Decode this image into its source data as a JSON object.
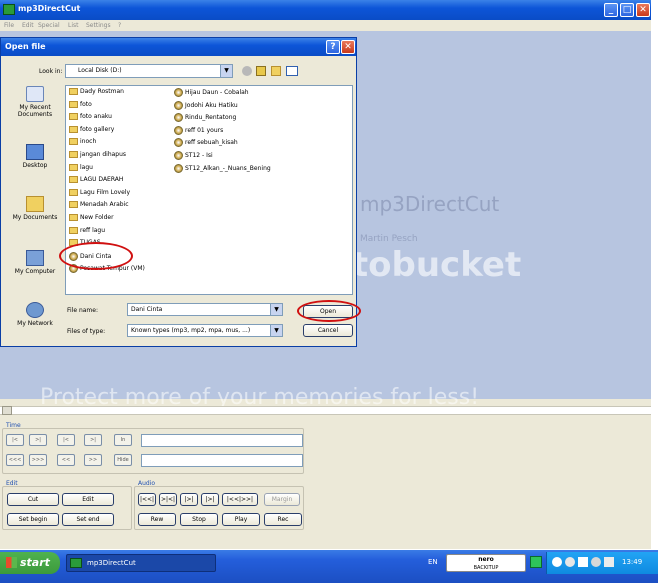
{
  "app": {
    "title": "mp3DirectCut",
    "menu": [
      "File",
      "Edit",
      "Special",
      "List",
      "Settings",
      "?"
    ],
    "window_buttons": [
      "_",
      "□",
      "✕"
    ],
    "background_title": "mp3DirectCut",
    "background_author": "Martin Pesch",
    "watermark_brand": "photobucket",
    "watermark_slogan": "Protect more of your memories for less!"
  },
  "dialog": {
    "title": "Open file",
    "help_btn": "?",
    "close_btn": "✕",
    "look_in_label": "Look in:",
    "look_in_value": "Local Disk (D:)",
    "places": [
      {
        "label": "My Recent Documents",
        "icon": "recent-documents-icon"
      },
      {
        "label": "Desktop",
        "icon": "desktop-icon"
      },
      {
        "label": "My Documents",
        "icon": "my-documents-icon"
      },
      {
        "label": "My Computer",
        "icon": "my-computer-icon"
      },
      {
        "label": "My Network",
        "icon": "my-network-icon"
      }
    ],
    "files_col1": [
      {
        "name": "Dady Rostman",
        "type": "folder"
      },
      {
        "name": "foto",
        "type": "folder"
      },
      {
        "name": "foto anaku",
        "type": "folder"
      },
      {
        "name": "foto gallery",
        "type": "folder"
      },
      {
        "name": "inoch",
        "type": "folder"
      },
      {
        "name": "jangan dihapus",
        "type": "folder"
      },
      {
        "name": "lagu",
        "type": "folder"
      },
      {
        "name": "LAGU DAERAH",
        "type": "folder"
      },
      {
        "name": "Lagu Film Lovely",
        "type": "folder"
      },
      {
        "name": "Menadah Arabic",
        "type": "folder"
      },
      {
        "name": "New Folder",
        "type": "folder"
      },
      {
        "name": "reff lagu",
        "type": "folder"
      },
      {
        "name": "TUGAS",
        "type": "folder"
      },
      {
        "name": "Dani Cinta",
        "type": "mp3"
      },
      {
        "name": "Pesawat Tempur (VM)",
        "type": "mp3"
      }
    ],
    "files_col2": [
      {
        "name": "Hijau Daun - Cobalah"
      },
      {
        "name": "Jodohi Aku Hatiku"
      },
      {
        "name": "Rindu_Rentatong"
      },
      {
        "name": "reff 01 yours"
      },
      {
        "name": "reff sebuah_kisah"
      },
      {
        "name": "ST12 - Isi"
      },
      {
        "name": "ST12_Alkan_-_Nuans_Bening"
      }
    ],
    "filename_label": "File name:",
    "filename_value": "Dani Cinta",
    "filetype_label": "Files of type:",
    "filetype_value": "Known types (mp3, mp2, mpa, mus, ...)",
    "open_btn": "Open",
    "cancel_btn": "Cancel"
  },
  "panel": {
    "time_label": "Time",
    "row1_buttons": [
      "|<",
      ">|",
      "|<",
      ">|"
    ],
    "row2_buttons": [
      "<<<",
      ">>>",
      "<<",
      ">>"
    ],
    "in_btn": "In",
    "hide_btn": "Hide",
    "edit_label": "Edit",
    "cut_btn": "Cut",
    "edit_btn": "Edit",
    "set_begin_btn": "Set begin",
    "set_end_btn": "Set end",
    "audio_label": "Audio",
    "audio_buttons": [
      "|<<|",
      ">|<|",
      "|>|",
      "|>|",
      "|<<|>>|",
      "Margin"
    ],
    "rew_btn": "Rew",
    "stop_btn": "Stop",
    "play_btn": "Play",
    "rec_btn": "Rec"
  },
  "taskbar": {
    "start": "start",
    "task_item": "mp3DirectCut",
    "lang": "EN",
    "brand": "nero",
    "brand_sub": "BACKITUP",
    "clock": "13:49"
  },
  "colors": {
    "xp_blue": "#0d55d8",
    "taskbar_blue": "#245edb",
    "start_green": "#3c9a3c",
    "highlight_red": "#d01010",
    "dialog_bg": "#ece9d8"
  }
}
